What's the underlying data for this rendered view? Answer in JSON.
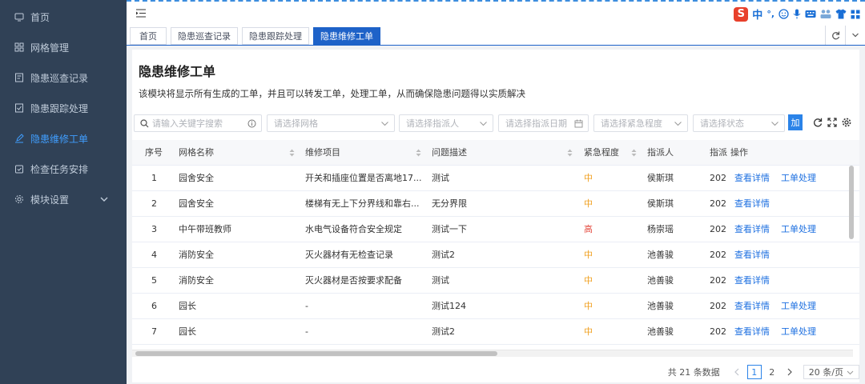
{
  "colors": {
    "sidebar_bg": "#304156",
    "accent": "#1e62c8",
    "link": "#1e70e0",
    "mid": "#f0a020",
    "high": "#e54d42"
  },
  "sidebar": {
    "items": [
      {
        "label": "首页",
        "icon": "monitor-icon"
      },
      {
        "label": "网格管理",
        "icon": "grid-icon"
      },
      {
        "label": "隐患巡查记录",
        "icon": "record-icon"
      },
      {
        "label": "隐患跟踪处理",
        "icon": "track-icon"
      },
      {
        "label": "隐患维修工单",
        "icon": "edit-icon",
        "active": true
      },
      {
        "label": "检查任务安排",
        "icon": "task-icon"
      },
      {
        "label": "模块设置",
        "icon": "gear-icon"
      }
    ]
  },
  "ime": {
    "logo": "S",
    "lang": "中",
    "punct": "°,"
  },
  "tabs": [
    {
      "label": "首页"
    },
    {
      "label": "隐患巡查记录"
    },
    {
      "label": "隐患跟踪处理"
    },
    {
      "label": "隐患维修工单",
      "active": true
    }
  ],
  "page": {
    "title": "隐患维修工单",
    "description": "该模块将显示所有生成的工单，并且可以转发工单，处理工单，从而确保隐患问题得以实质解决"
  },
  "filters": {
    "keyword": "请输入关键字搜索",
    "grid": "请选择网格",
    "assignee": "请选择指派人",
    "date": "请选择指派日期",
    "urgency": "请选择紧急程度",
    "status": "请选择状态",
    "add_label": "加"
  },
  "table": {
    "headers": {
      "no": "序号",
      "grid": "网格名称",
      "item": "维修项目",
      "issue": "问题描述",
      "urgency": "紧急程度",
      "assignee": "指派人",
      "date": "指派",
      "action": "操作"
    },
    "view_label": "查看详情",
    "process_label": "工单处理",
    "rows": [
      {
        "no": "1",
        "grid": "园舍安全",
        "item": "开关和插座位置是否离地17...",
        "issue": "测试",
        "urgency": "中",
        "level": "mid",
        "assignee": "侯斯琪",
        "date": "202",
        "process": true
      },
      {
        "no": "2",
        "grid": "园舍安全",
        "item": "楼梯有无上下分界线和靠右...",
        "issue": "无分界限",
        "urgency": "中",
        "level": "mid",
        "assignee": "侯斯琪",
        "date": "202",
        "process": false
      },
      {
        "no": "3",
        "grid": "中午带班教师",
        "item": "水电气设备符合安全规定",
        "issue": "测试一下",
        "urgency": "高",
        "level": "high",
        "assignee": "杨崇瑶",
        "date": "202",
        "process": true
      },
      {
        "no": "4",
        "grid": "消防安全",
        "item": "灭火器材有无检查记录",
        "issue": "测试2",
        "urgency": "中",
        "level": "mid",
        "assignee": "池善骏",
        "date": "202",
        "process": false
      },
      {
        "no": "5",
        "grid": "消防安全",
        "item": "灭火器材是否按要求配备",
        "issue": "测试",
        "urgency": "中",
        "level": "mid",
        "assignee": "池善骏",
        "date": "202",
        "process": false
      },
      {
        "no": "6",
        "grid": "园长",
        "item": "-",
        "issue": "测试124",
        "urgency": "中",
        "level": "mid",
        "assignee": "池善骏",
        "date": "202",
        "process": true
      },
      {
        "no": "7",
        "grid": "园长",
        "item": "-",
        "issue": "测试2",
        "urgency": "中",
        "level": "mid",
        "assignee": "池善骏",
        "date": "202",
        "process": true
      }
    ]
  },
  "pagination": {
    "total_text": "共 21 条数据",
    "pages": [
      "1",
      "2"
    ],
    "current": "1",
    "page_size": "20 条/页"
  }
}
